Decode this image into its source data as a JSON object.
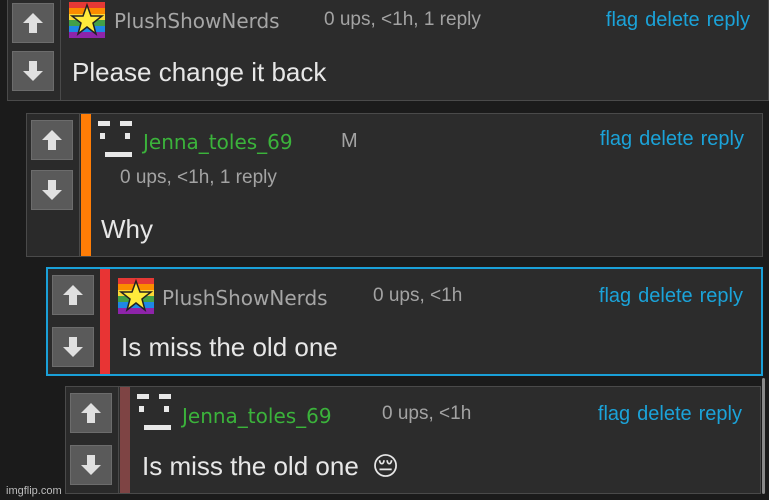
{
  "actions": {
    "flag": "flag",
    "delete": "delete",
    "reply": "reply"
  },
  "colors": {
    "stripe_orange": "#ff7d06",
    "stripe_red": "#e83434",
    "stripe_brown": "#7e4444",
    "highlight_border": "#1aa0d8",
    "username_green": "#3bb33b",
    "action_blue": "#1ba3d9"
  },
  "comments": [
    {
      "username": "PlushShowNerds",
      "meta": "0 ups, <1h, 1 reply",
      "text": "Please change it back",
      "avatar": "rainbow-star"
    },
    {
      "username": "Jenna_toles_69",
      "gender": "M",
      "meta": "0 ups, <1h, 1 reply",
      "text": "Why",
      "avatar": "face-glyph"
    },
    {
      "username": "PlushShowNerds",
      "meta": "0 ups, <1h",
      "text": "Is miss the old one",
      "avatar": "rainbow-star"
    },
    {
      "username": "Jenna_toles_69",
      "meta": "0 ups, <1h",
      "text": "Is miss the old one",
      "emoji": "😔",
      "avatar": "face-glyph"
    }
  ],
  "watermark": "imgflip.com"
}
